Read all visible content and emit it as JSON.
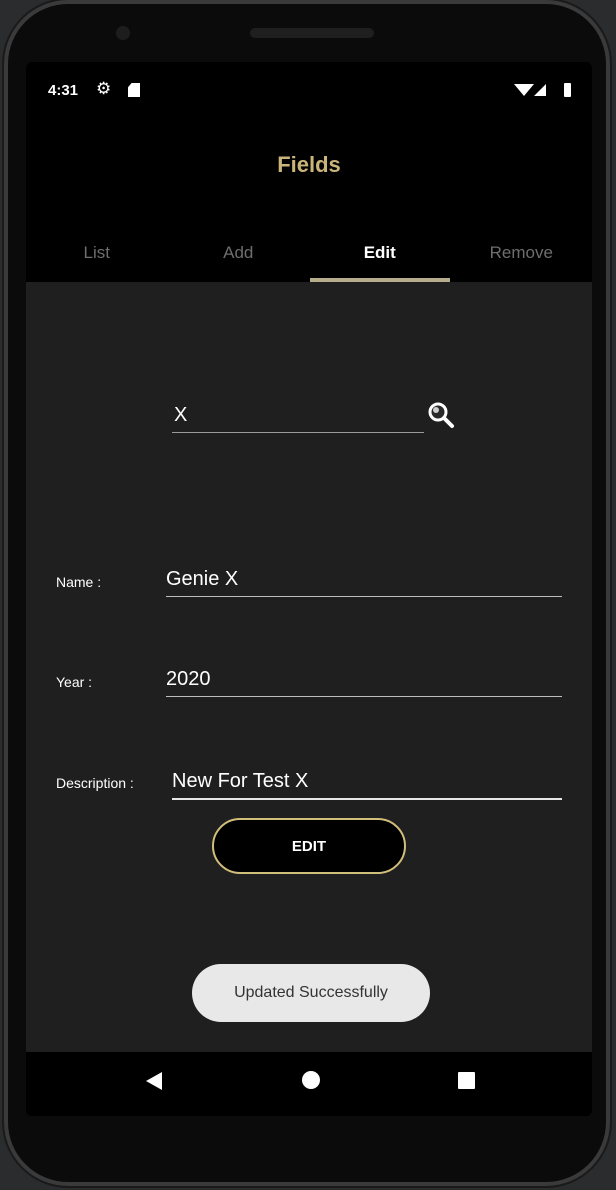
{
  "status_bar": {
    "time": "4:31",
    "icons": [
      "gear-icon",
      "sd-card-icon",
      "wifi-icon",
      "signal-icon",
      "battery-icon"
    ]
  },
  "app": {
    "title": "Fields",
    "accent_color": "#c9b57a"
  },
  "tabs": [
    {
      "label": "List",
      "active": false
    },
    {
      "label": "Add",
      "active": false
    },
    {
      "label": "Edit",
      "active": true
    },
    {
      "label": "Remove",
      "active": false
    }
  ],
  "search": {
    "value": "X",
    "icon": "search-icon"
  },
  "form": {
    "name_label": "Name :",
    "name_value": "Genie X",
    "year_label": "Year :",
    "year_value": "2020",
    "description_label": "Description :",
    "description_value": "New For Test X"
  },
  "edit_button": {
    "label": "EDIT",
    "border_color": "#d2be7b"
  },
  "toast": {
    "message": "Updated Successfully"
  },
  "nav_bar": {
    "icons": [
      "back-icon",
      "home-icon",
      "recents-icon"
    ]
  }
}
